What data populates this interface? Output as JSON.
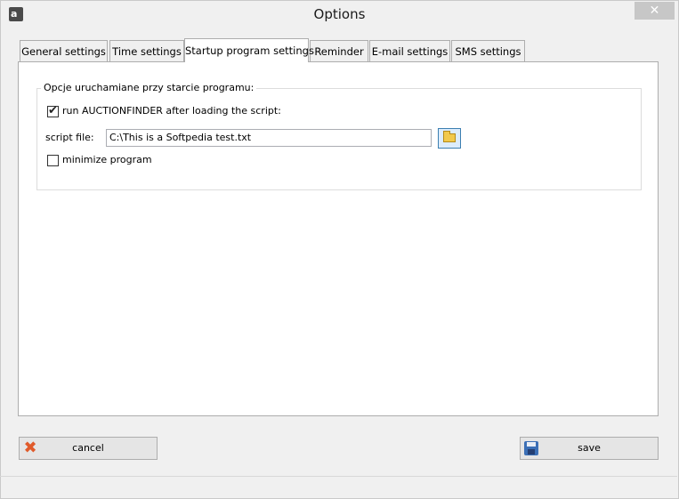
{
  "window": {
    "title": "Options",
    "icon_text": "a",
    "close_label": "✕"
  },
  "tabs": [
    {
      "label": "General settings",
      "active": false
    },
    {
      "label": "Time settings",
      "active": false
    },
    {
      "label": "Startup program settings",
      "active": true
    },
    {
      "label": "Reminder",
      "active": false
    },
    {
      "label": "E-mail settings",
      "active": false
    },
    {
      "label": "SMS settings",
      "active": false
    }
  ],
  "startup": {
    "group_title": "Opcje uruchamiane przy starcie programu:",
    "run_checkbox": {
      "label": "run AUCTIONFINDER after loading the script:",
      "checked": true,
      "mark": "✔"
    },
    "script_file_label": "script file:",
    "script_file_value": "C:\\This is a Softpedia test.txt",
    "browse_icon": "folder-icon",
    "minimize_checkbox": {
      "label": "minimize program",
      "checked": false
    }
  },
  "buttons": {
    "cancel_label": "cancel",
    "cancel_icon": "x-icon",
    "save_label": "save",
    "save_icon": "disk-icon"
  },
  "colors": {
    "accent": "#3c7fb1",
    "background": "#f0f0f0",
    "panel": "#ffffff"
  }
}
